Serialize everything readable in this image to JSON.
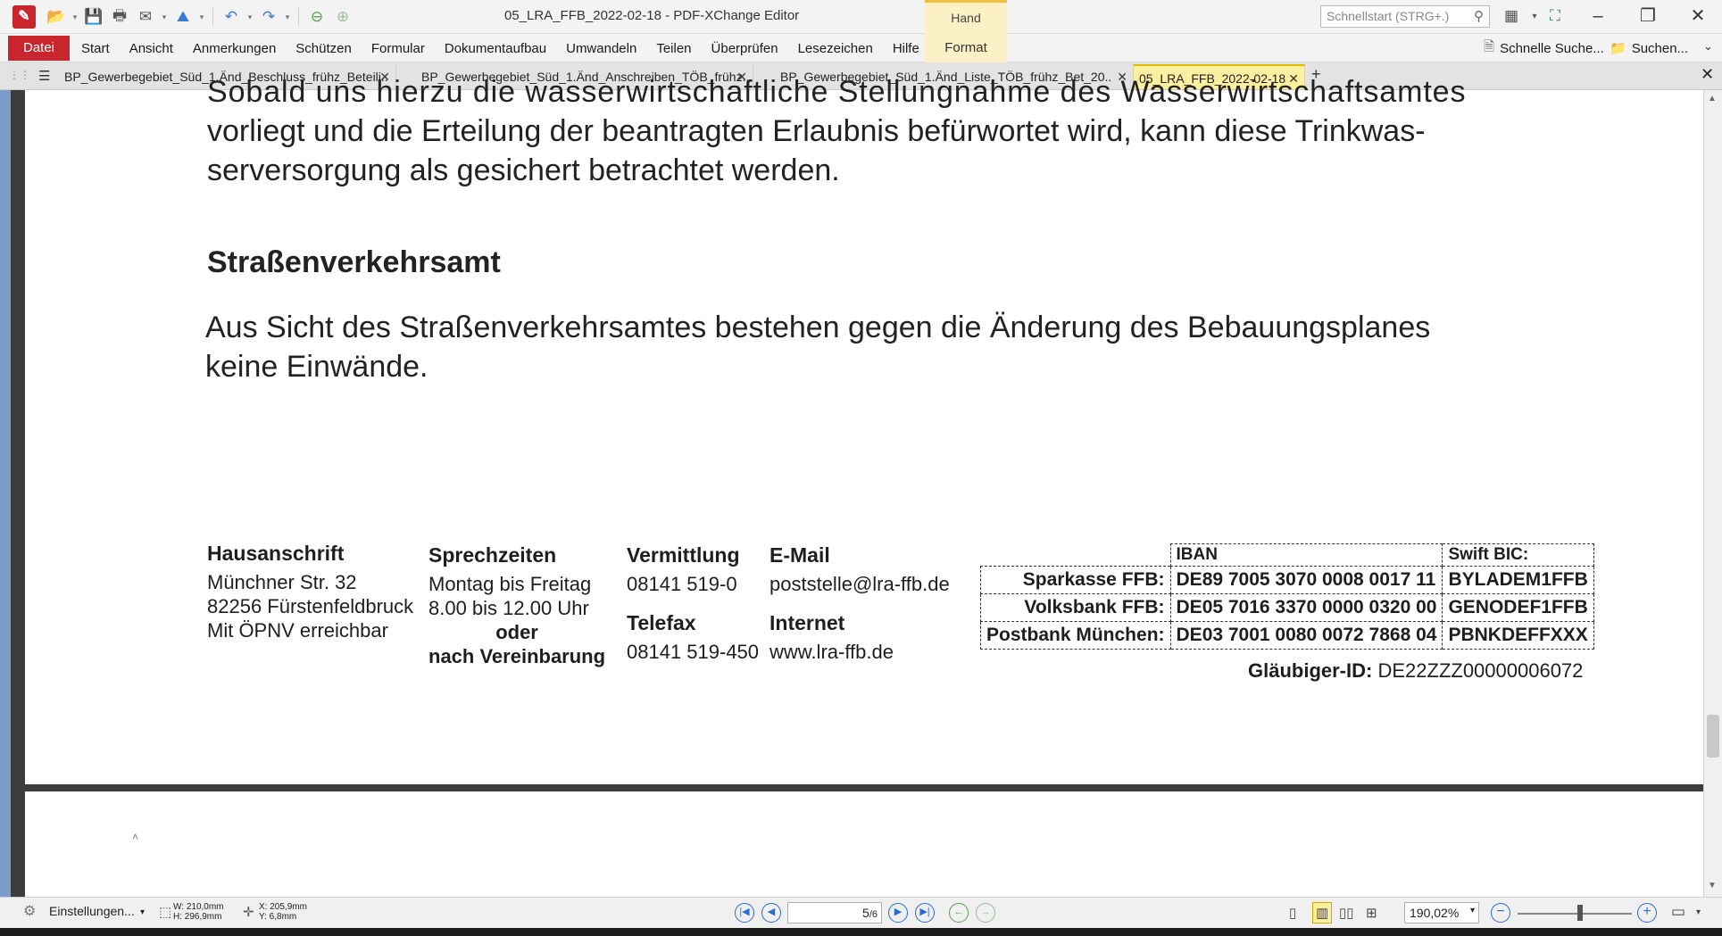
{
  "window": {
    "title": "05_LRA_FFB_2022-02-18 - PDF-XChange Editor",
    "context_tab": "Hand",
    "quick_search_placeholder": "Schnellstart (STRG+.)"
  },
  "menu": {
    "file": "Datei",
    "items": [
      "Start",
      "Ansicht",
      "Anmerkungen",
      "Schützen",
      "Formular",
      "Dokumentaufbau",
      "Umwandeln",
      "Teilen",
      "Überprüfen",
      "Lesezeichen",
      "Hilfe"
    ],
    "context": "Format",
    "fast_search": "Schnelle Suche...",
    "search": "Suchen..."
  },
  "tabs": [
    {
      "label": "BP_Gewerbegebiet_Süd_1.Änd_Beschluss_frühz_Beteili.."
    },
    {
      "label": "BP_Gewerbegebiet_Süd_1.Änd_Anschreiben_TÖB_frühz.."
    },
    {
      "label": "BP_Gewerbegebiet_Süd_1.Änd_Liste_TÖB_frühz_Bet_20.."
    },
    {
      "label": "05_LRA_FFB_2022-02-18"
    }
  ],
  "document": {
    "cut_line": "Sobald uns hierzu die wasserwirtschaftliche Stellungnahme des Wasserwirtschaftsamtes",
    "para1_line1": "vorliegt und die Erteilung der beantragten Erlaubnis befürwortet wird, kann diese Trinkwas-",
    "para1_line2": "serversorgung als gesichert betrachtet werden.",
    "heading": "Straßenverkehrsamt",
    "para2_line1": "Aus Sicht des Straßenverkehrsamtes bestehen gegen die Änderung des Bebauungsplanes",
    "para2_line2": "keine Einwände.",
    "footer": {
      "address": {
        "head": "Hausanschrift",
        "l1": "Münchner Str. 32",
        "l2": "82256 Fürstenfeldbruck",
        "l3": "Mit ÖPNV erreichbar"
      },
      "hours": {
        "head": "Sprechzeiten",
        "l1": "Montag bis Freitag",
        "l2": "8.00 bis 12.00 Uhr",
        "l3": "oder",
        "l4": "nach Vereinbarung"
      },
      "phone": {
        "head": "Vermittlung",
        "value": "08141 519-0",
        "fax_head": "Telefax",
        "fax_value": "08141 519-450"
      },
      "email": {
        "head": "E-Mail",
        "value": "poststelle@lra-ffb.de",
        "web_head": "Internet",
        "web_value": "www.lra-ffb.de"
      },
      "bank": {
        "iban_head": "IBAN",
        "bic_head": "Swift BIC:",
        "rows": [
          {
            "name": "Sparkasse FFB:",
            "iban": "DE89 7005 3070 0008 0017 11",
            "bic": "BYLADEM1FFB"
          },
          {
            "name": "Volksbank FFB:",
            "iban": "DE05 7016 3370 0000 0320 00",
            "bic": "GENODEF1FFB"
          },
          {
            "name": "Postbank München:",
            "iban": "DE03 7001 0080 0072 7868 04",
            "bic": "PBNKDEFFXXX"
          }
        ]
      },
      "creditor_label": "Gläubiger-ID:",
      "creditor_value": "DE22ZZZ00000006072"
    }
  },
  "statusbar": {
    "settings": "Einstellungen...",
    "width": "W: 210,0mm",
    "height": "H: 296,9mm",
    "x": "X: 205,9mm",
    "y": "Y: 6,8mm",
    "page_current": "5",
    "page_total": "6",
    "zoom": "190,02%"
  }
}
